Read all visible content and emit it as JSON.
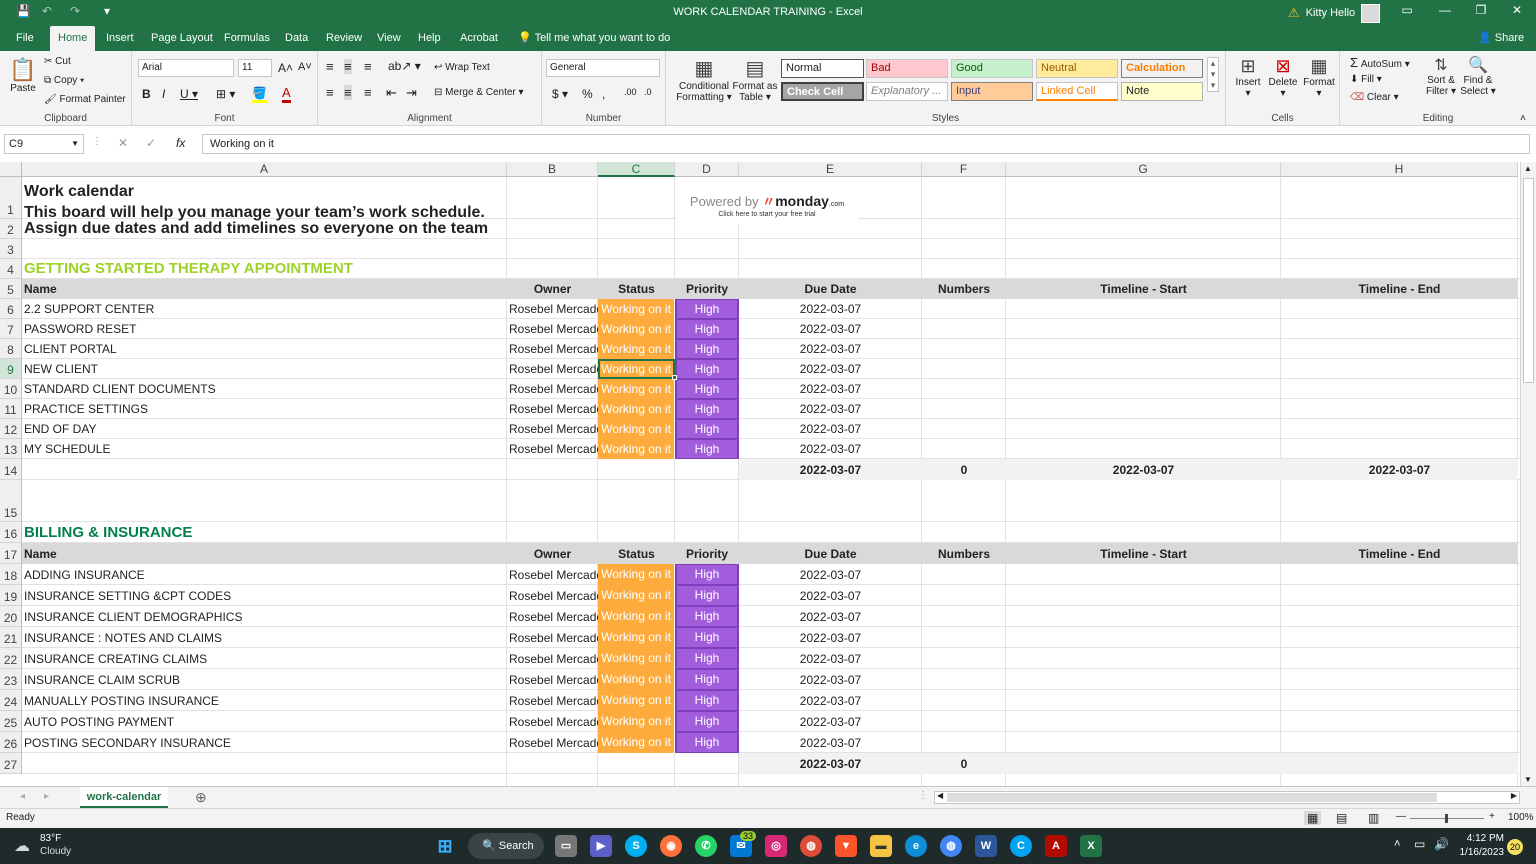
{
  "window": {
    "title": "WORK CALENDAR TRAINING  -  Excel",
    "user": "Kitty Hello"
  },
  "ribbon_tabs": [
    "File",
    "Home",
    "Insert",
    "Page Layout",
    "Formulas",
    "Data",
    "Review",
    "View",
    "Help",
    "Acrobat"
  ],
  "active_tab": "Home",
  "tell_me": "Tell me what you want to do",
  "share": "Share",
  "clipboard": {
    "paste": "Paste",
    "cut": "Cut",
    "copy": "Copy",
    "format_painter": "Format Painter",
    "label": "Clipboard"
  },
  "font": {
    "name": "Arial",
    "size": "11",
    "label": "Font"
  },
  "alignment": {
    "wrap": "Wrap Text",
    "merge": "Merge & Center",
    "label": "Alignment"
  },
  "number": {
    "format": "General",
    "label": "Number"
  },
  "styles": {
    "conditional": "Conditional",
    "formatting": "Formatting",
    "format_as": "Format as",
    "table": "Table",
    "normal": "Normal",
    "bad": "Bad",
    "good": "Good",
    "neutral": "Neutral",
    "calculation": "Calculation",
    "check_cell": "Check Cell",
    "explanatory": "Explanatory ...",
    "input": "Input",
    "linked_cell": "Linked Cell",
    "note": "Note",
    "label": "Styles"
  },
  "cells_group": {
    "insert": "Insert",
    "delete": "Delete",
    "format": "Format",
    "label": "Cells"
  },
  "editing": {
    "autosum": "AutoSum",
    "fill": "Fill",
    "clear": "Clear",
    "sort": "Sort &",
    "filter": "Filter",
    "find": "Find &",
    "select": "Select",
    "label": "Editing"
  },
  "formula_bar": {
    "name_box": "C9",
    "fx": "fx",
    "content": "Working on it"
  },
  "columns": [
    "A",
    "B",
    "C",
    "D",
    "E",
    "F",
    "G",
    "H"
  ],
  "row_numbers": [
    "1",
    "2",
    "3",
    "4",
    "5",
    "6",
    "7",
    "8",
    "9",
    "10",
    "11",
    "12",
    "13",
    "14",
    "15",
    "16",
    "17",
    "18",
    "19",
    "20",
    "21",
    "22",
    "23",
    "24",
    "25",
    "26",
    "27"
  ],
  "sheet": {
    "title": "Work calendar",
    "description_1": "This board will help you manage your team’s work schedule.",
    "description_2": "Assign due dates and add timelines so everyone on the team",
    "powered_by": "Powered by",
    "monday_logo": "monday",
    "monday_suffix": ".com",
    "trial": "Click here to start your free trial",
    "headers": {
      "name": "Name",
      "owner": "Owner",
      "status": "Status",
      "priority": "Priority",
      "due": "Due Date",
      "numbers": "Numbers",
      "tstart": "Timeline - Start",
      "tend": "Timeline - End"
    },
    "group1": {
      "title": "GETTING STARTED THERAPY APPOINTMENT",
      "rows": [
        {
          "name": "2.2  SUPPORT CENTER",
          "owner": "Rosebel Mercado",
          "status": "Working on it",
          "priority": "High",
          "due": "2022-03-07"
        },
        {
          "name": "PASSWORD RESET",
          "owner": "Rosebel Mercado",
          "status": "Working on it",
          "priority": "High",
          "due": "2022-03-07"
        },
        {
          "name": "CLIENT PORTAL",
          "owner": "Rosebel Mercado",
          "status": "Working on it",
          "priority": "High",
          "due": "2022-03-07"
        },
        {
          "name": "NEW CLIENT",
          "owner": "Rosebel Mercado",
          "status": "Working on it",
          "priority": "High",
          "due": "2022-03-07"
        },
        {
          "name": "STANDARD CLIENT DOCUMENTS",
          "owner": "Rosebel Mercado",
          "status": "Working on it",
          "priority": "High",
          "due": "2022-03-07"
        },
        {
          "name": "PRACTICE SETTINGS",
          "owner": "Rosebel Mercado",
          "status": "Working on it",
          "priority": "High",
          "due": "2022-03-07"
        },
        {
          "name": "END OF DAY",
          "owner": "Rosebel Mercado",
          "status": "Working on it",
          "priority": "High",
          "due": "2022-03-07"
        },
        {
          "name": "MY SCHEDULE",
          "owner": "Rosebel Mercado",
          "status": "Working on it",
          "priority": "High",
          "due": "2022-03-07"
        }
      ],
      "summary": {
        "due": "2022-03-07",
        "numbers": "0",
        "tstart": "2022-03-07",
        "tend": "2022-03-07"
      }
    },
    "group2": {
      "title": "BILLING  & INSURANCE",
      "rows": [
        {
          "name": "ADDING INSURANCE",
          "owner": "Rosebel Mercado",
          "status": "Working on it",
          "priority": "High",
          "due": "2022-03-07"
        },
        {
          "name": "INSURANCE SETTING &CPT CODES",
          "owner": "Rosebel Mercado",
          "status": "Working on it",
          "priority": "High",
          "due": "2022-03-07"
        },
        {
          "name": "INSURANCE CLIENT DEMOGRAPHICS",
          "owner": "Rosebel Mercado",
          "status": "Working on it",
          "priority": "High",
          "due": "2022-03-07"
        },
        {
          "name": "INSURANCE : NOTES AND CLAIMS",
          "owner": "Rosebel Mercado",
          "status": "Working on it",
          "priority": "High",
          "due": "2022-03-07"
        },
        {
          "name": "INSURANCE CREATING CLAIMS",
          "owner": "Rosebel Mercado",
          "status": "Working on it",
          "priority": "High",
          "due": "2022-03-07"
        },
        {
          "name": "INSURANCE CLAIM SCRUB",
          "owner": "Rosebel Mercado",
          "status": "Working on it",
          "priority": "High",
          "due": "2022-03-07"
        },
        {
          "name": "MANUALLY POSTING INSURANCE",
          "owner": "Rosebel Mercado",
          "status": "Working on it",
          "priority": "High",
          "due": "2022-03-07"
        },
        {
          "name": "AUTO POSTING PAYMENT",
          "owner": "Rosebel Mercado",
          "status": "Working on it",
          "priority": "High",
          "due": "2022-03-07"
        },
        {
          "name": "POSTING SECONDARY INSURANCE",
          "owner": "Rosebel Mercado",
          "status": "Working on it",
          "priority": "High",
          "due": "2022-03-07"
        }
      ],
      "summary": {
        "due": "2022-03-07",
        "numbers": "0"
      }
    }
  },
  "sheet_tab": "work-calendar",
  "status_bar": {
    "ready": "Ready",
    "zoom": "100%"
  },
  "taskbar": {
    "weather_temp": "83°F",
    "weather_desc": "Cloudy",
    "search": "Search",
    "mail_badge": "33",
    "time": "4:12 PM",
    "date": "1/16/2023",
    "notif": "20"
  },
  "colors": {
    "excel_green": "#217346",
    "status_orange": "#fdab3d",
    "priority_purple": "#a25ddc",
    "group1_title": "#9cd326",
    "group2_title": "#037f4c"
  }
}
